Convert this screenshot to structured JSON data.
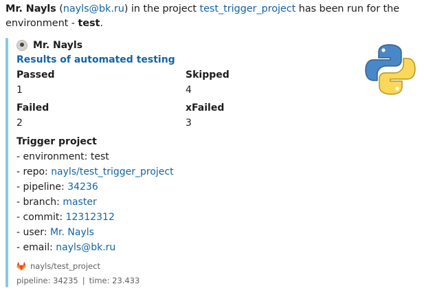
{
  "intro": {
    "user_name": "Mr. Nayls",
    "open_paren": " (",
    "user_email": "nayls@bk.ru",
    "mid_text": ") in the project ",
    "project_name": "test_trigger_project",
    "end_text": " has been run for the environment - ",
    "environment": "test",
    "period": "."
  },
  "attachment": {
    "bar_color": "#88c9e8",
    "author_name": "Mr. Nayls",
    "author_icon": "avatar-icon",
    "title": "Results of automated testing",
    "thumb_icon": "python-logo-icon",
    "fields": [
      {
        "label": "Passed",
        "value": "1"
      },
      {
        "label": "Skipped",
        "value": "4"
      },
      {
        "label": "Failed",
        "value": "2"
      },
      {
        "label": "xFailed",
        "value": "3"
      }
    ],
    "trigger": {
      "title": "Trigger project",
      "environment_label": "- environment: ",
      "environment_value": "test",
      "repo_label": "- repo: ",
      "repo_value": "nayls/test_trigger_project",
      "pipeline_label": "- pipeline: ",
      "pipeline_value": "34236",
      "branch_label": "- branch: ",
      "branch_value": "master",
      "commit_label": "- commit: ",
      "commit_value": "12312312",
      "user_label": "- user: ",
      "user_value": "Mr. Nayls",
      "email_label": "- email: ",
      "email_value": "nayls@bk.ru"
    },
    "footer_project": {
      "icon": "gitlab-icon",
      "text": "nayls/test_project"
    },
    "footer": {
      "pipeline": "pipeline: 34235",
      "separator": "|",
      "time": "time: 23.433"
    }
  }
}
